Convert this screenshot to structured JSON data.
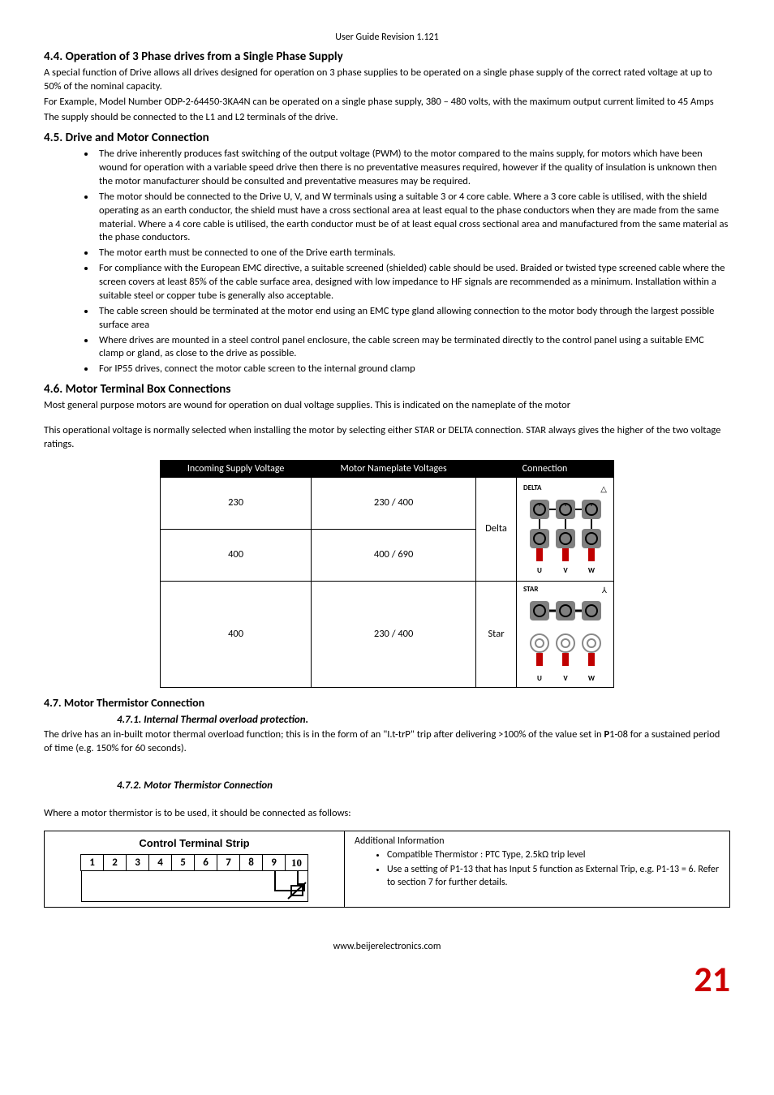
{
  "header": {
    "revision": "User Guide Revision 1.121"
  },
  "s44": {
    "title": "4.4. Operation of 3 Phase drives from a Single Phase Supply",
    "p1": "A special function of Drive allows all drives designed for operation on 3 phase supplies to be operated on a single phase supply of the correct rated voltage at up to 50% of the nominal capacity.",
    "p2": "For Example, Model Number ODP-2-64450-3KA4N can be operated on a single phase supply, 380 – 480 volts, with the maximum output current limited to 45 Amps",
    "p3": "The supply should be connected to the L1 and L2 terminals of the drive."
  },
  "s45": {
    "title": "4.5. Drive and Motor Connection",
    "bullets": [
      "The drive inherently produces fast switching of the output voltage (PWM) to the motor compared to the mains supply, for motors which have been wound for operation with a variable speed drive then there is no preventative measures required, however if the quality of insulation is unknown then the motor manufacturer should be consulted and preventative measures may be required.",
      "The motor should be connected to the Drive U, V, and W terminals using a suitable 3 or 4 core cable. Where a 3 core cable is utilised, with the shield operating as an earth conductor, the shield must have a cross sectional area at least equal to the phase conductors when they are made from the same material. Where a 4 core cable is utilised, the earth conductor must be of at least equal cross sectional area and manufactured from the same material as the phase conductors.",
      "The motor earth must be connected to one of the Drive earth terminals.",
      "For compliance with the European EMC directive, a suitable screened (shielded) cable should be used. Braided or twisted type screened cable where the screen covers at least 85% of the cable surface area, designed with low impedance to HF signals are recommended as a minimum. Installation within a suitable steel or copper tube is generally also acceptable.",
      "The cable screen should be terminated at the motor end using an EMC type gland allowing connection to the motor body through the largest possible surface area",
      "Where drives are mounted in a steel control panel enclosure, the cable screen may be terminated directly to the control panel using a suitable EMC clamp or gland, as close to the drive as possible.",
      "For IP55 drives, connect the motor cable screen to the internal ground clamp"
    ]
  },
  "s46": {
    "title": "4.6. Motor Terminal Box Connections",
    "p1": "Most general purpose motors are wound for operation on dual voltage supplies. This is indicated on the nameplate of the motor",
    "p2": "This operational voltage is normally selected when installing the motor by selecting either STAR or DELTA connection.  STAR always gives the higher of the two voltage ratings.",
    "table": {
      "headers": [
        "Incoming Supply Voltage",
        "Motor Nameplate Voltages",
        "Connection"
      ],
      "rows": [
        {
          "supply": "230",
          "nameplate": "230 / 400",
          "conn": "Delta"
        },
        {
          "supply": "400",
          "nameplate": "400 / 690",
          "conn": "Delta"
        },
        {
          "supply": "400",
          "nameplate": "230 / 400",
          "conn": "Star"
        }
      ],
      "delta_label": "DELTA",
      "star_label": "STAR",
      "uvw": "U V W"
    }
  },
  "s47": {
    "title": "4.7. Motor Thermistor Connection",
    "s471_title": "4.7.1. Internal Thermal overload protection.",
    "s471_p_a": "The drive has an in-built motor thermal overload function; this is in the form of an \"I.t-trP\" trip after delivering >100% of the value set in ",
    "s471_p_b": "P",
    "s471_p_c": "1-08 for a sustained period of time (e.g. 150% for 60 seconds).",
    "s472_title": "4.7.2. Motor Thermistor Connection",
    "s472_intro": "Where a motor thermistor is to be used, it should be connected as follows:",
    "strip_title": "Control Terminal Strip",
    "strip_nums": [
      "1",
      "2",
      "3",
      "4",
      "5",
      "6",
      "7",
      "8",
      "9",
      "10"
    ],
    "add_info_title": "Additional Information",
    "add_info": [
      "Compatible Thermistor : PTC Type, 2.5kΩ trip level",
      "Use a setting of P1-13 that has Input 5 function as External Trip, e.g. P1-13 = 6. Refer to section 7 for further details."
    ]
  },
  "footer": {
    "url": "www.beijerelectronics.com",
    "page": "21"
  }
}
